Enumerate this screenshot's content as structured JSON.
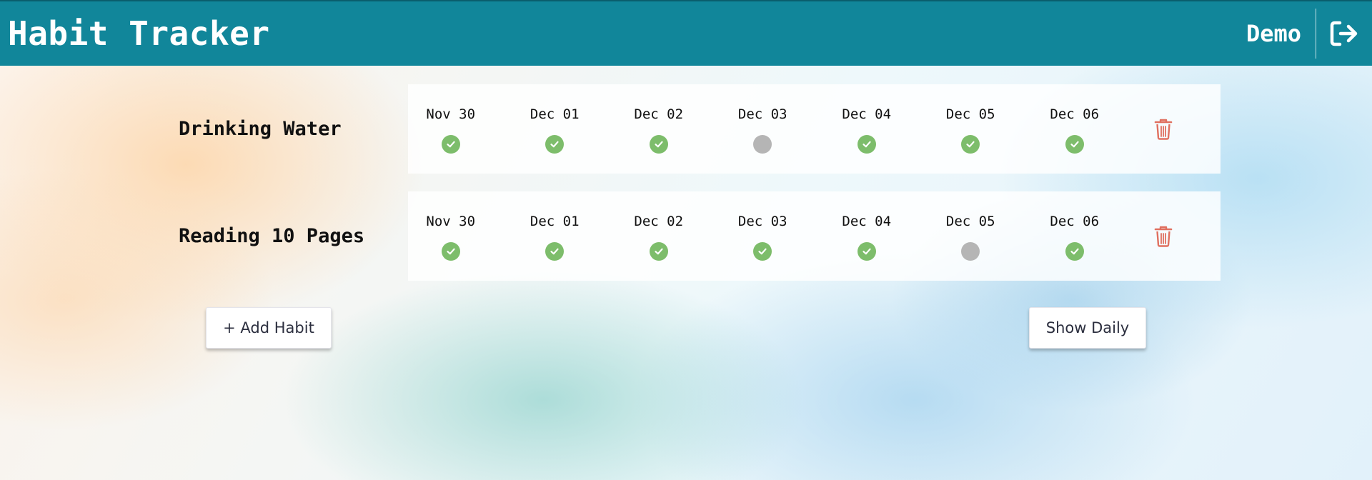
{
  "header": {
    "title": "Habit Tracker",
    "user": "Demo",
    "logout_icon": "logout-icon",
    "background_color": "#11869a"
  },
  "habits": [
    {
      "name": "Drinking Water",
      "days": [
        {
          "date": "Nov 30",
          "status": "done"
        },
        {
          "date": "Dec 01",
          "status": "done"
        },
        {
          "date": "Dec 02",
          "status": "done"
        },
        {
          "date": "Dec 03",
          "status": "missed"
        },
        {
          "date": "Dec 04",
          "status": "done"
        },
        {
          "date": "Dec 05",
          "status": "done"
        },
        {
          "date": "Dec 06",
          "status": "done"
        }
      ]
    },
    {
      "name": "Reading 10 Pages",
      "days": [
        {
          "date": "Nov 30",
          "status": "done"
        },
        {
          "date": "Dec 01",
          "status": "done"
        },
        {
          "date": "Dec 02",
          "status": "done"
        },
        {
          "date": "Dec 03",
          "status": "done"
        },
        {
          "date": "Dec 04",
          "status": "done"
        },
        {
          "date": "Dec 05",
          "status": "missed"
        },
        {
          "date": "Dec 06",
          "status": "done"
        }
      ]
    }
  ],
  "actions": {
    "add_habit": "+ Add Habit",
    "show_daily": "Show Daily"
  },
  "colors": {
    "done": "#7dbd6b",
    "missed": "#b5b5b5",
    "delete": "#e07060"
  }
}
